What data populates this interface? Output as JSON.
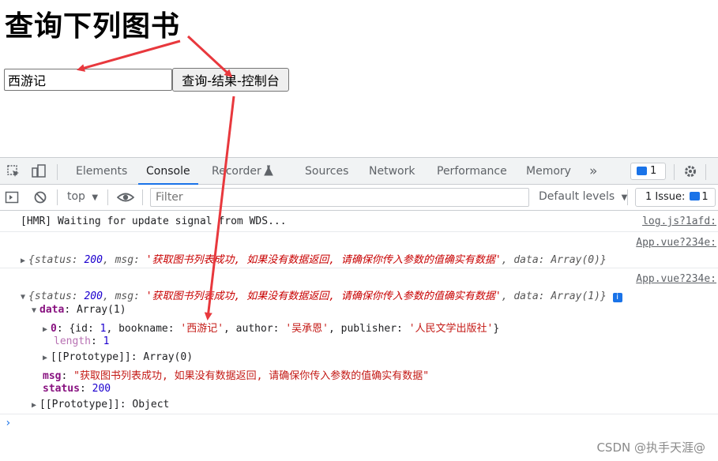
{
  "page": {
    "title": "查询下列图书",
    "input_value": "西游记",
    "button_label": "查询-结果-控制台"
  },
  "devtools": {
    "tabs": [
      "Elements",
      "Console",
      "Recorder",
      "Sources",
      "Network",
      "Performance",
      "Memory"
    ],
    "active_tab": "Console",
    "more_tabs": "»",
    "message_count": "1",
    "context": "top",
    "filter_placeholder": "Filter",
    "default_levels": "Default levels",
    "issues_label": "1 Issue:",
    "issues_count": "1"
  },
  "console": {
    "hmr_message": "[HMR] Waiting for update signal from WDS...",
    "hmr_source": "log.js?1afd:",
    "source_app": "App.vue?234e:",
    "obj_status_key": "status",
    "obj_status_val": "200",
    "obj_msg_key": "msg",
    "obj_msg_val": "'获取图书列表成功, 如果没有数据返回, 请确保你传入参数的值确实有数据'",
    "obj_data_key": "data",
    "obj_data_val0": "Array(0)",
    "obj_data_val1": "Array(1)",
    "expanded_data": "data: Array(1)",
    "item0_key": "0",
    "item0_id": "1",
    "item0_bookname": "'西游记'",
    "item0_author": "'吴承恩'",
    "item0_publisher": "'人民文学出版社'",
    "length_key": "length",
    "length_val": "1",
    "proto_array": "Array(0)",
    "proto_label": "[[Prototype]]",
    "msg_line_key": "msg",
    "msg_line_val": "\"获取图书列表成功, 如果没有数据返回, 请确保你传入参数的值确实有数据\"",
    "status_line_key": "status",
    "status_line_val": "200",
    "proto_object": "Object",
    "prompt": "›"
  },
  "watermark": "CSDN @执手天涯@",
  "colors": {
    "arrow": "#e8383d",
    "accent": "#1a73e8"
  }
}
